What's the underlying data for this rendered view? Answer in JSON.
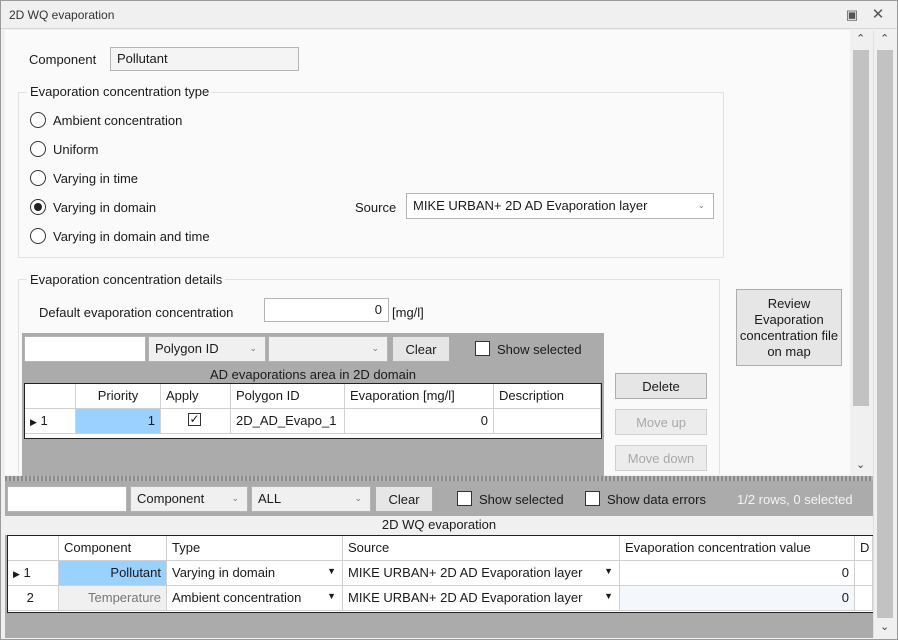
{
  "window": {
    "title": "2D WQ evaporation"
  },
  "component": {
    "label": "Component",
    "value": "Pollutant"
  },
  "evap_type": {
    "title": "Evaporation concentration type",
    "options": [
      {
        "label": "Ambient concentration",
        "selected": false
      },
      {
        "label": "Uniform",
        "selected": false
      },
      {
        "label": "Varying in time",
        "selected": false
      },
      {
        "label": "Varying in domain",
        "selected": true
      },
      {
        "label": "Varying in domain and time",
        "selected": false
      }
    ],
    "source_label": "Source",
    "source_value": "MIKE URBAN+ 2D AD Evaporation layer"
  },
  "evap_details": {
    "title": "Evaporation concentration details",
    "default_label": "Default evaporation concentration",
    "default_value": "0",
    "unit": "[mg/l]"
  },
  "review_button": "Review Evaporation concentration file on map",
  "inner_filter": {
    "search_value": "",
    "field_combo": "Polygon ID",
    "value_combo": "",
    "clear_label": "Clear",
    "show_selected_label": "Show selected"
  },
  "inner_table": {
    "caption": "AD evaporations area in 2D domain",
    "columns": [
      "Priority",
      "Apply",
      "Polygon ID",
      "Evaporation [mg/l]",
      "Description"
    ],
    "rows": [
      {
        "row_no": "1",
        "priority": "1",
        "apply": true,
        "polygon_id": "2D_AD_Evapo_1",
        "evaporation": "0",
        "description": ""
      }
    ]
  },
  "side_buttons": {
    "delete": "Delete",
    "move_up": "Move up",
    "move_down": "Move down"
  },
  "outer_filter": {
    "search_value": "",
    "field_combo": "Component",
    "value_combo": "ALL",
    "clear_label": "Clear",
    "show_selected_label": "Show selected",
    "show_errors_label": "Show data errors",
    "status": "1/2 rows, 0 selected"
  },
  "outer_table": {
    "caption": "2D WQ evaporation",
    "columns": [
      "Component",
      "Type",
      "Source",
      "Evaporation concentration value",
      "D"
    ],
    "rows": [
      {
        "row_no": "1",
        "component": "Pollutant",
        "type": "Varying in domain",
        "source": "MIKE URBAN+ 2D AD Evaporation layer",
        "value": "0"
      },
      {
        "row_no": "2",
        "component": "Temperature",
        "type": "Ambient concentration",
        "source": "MIKE URBAN+ 2D AD Evaporation layer",
        "value": "0"
      }
    ]
  },
  "colors": {
    "selected_cell": "#99d1ff",
    "grid_bg": "#ababab",
    "panel_bg": "#fafafa"
  },
  "icons": {
    "restore": "restore-icon",
    "close": "close-icon",
    "scroll_up": "chevron-up-icon",
    "scroll_down": "chevron-down-icon",
    "row_indicator": "row-pointer-icon",
    "dropdown": "chevron-down-icon"
  }
}
